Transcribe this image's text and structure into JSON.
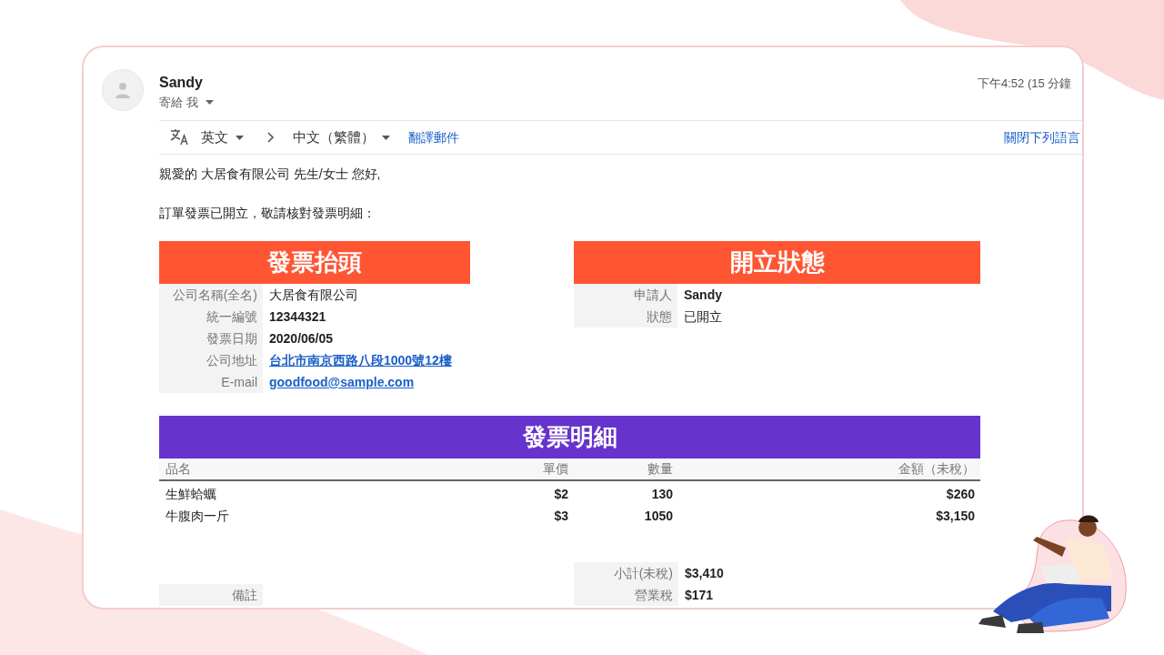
{
  "email": {
    "sender": "Sandy",
    "recipient": "寄給 我",
    "time": "下午4:52 (15 分鐘"
  },
  "translate_bar": {
    "from_language": "英文",
    "to_language": "中文（繁體）",
    "translate": "翻譯郵件",
    "turn_off": "關閉下列語言"
  },
  "greeting": "親愛的 大居食有限公司 先生/女士 您好,",
  "intro": "訂單發票已開立，敬請核對發票明細：",
  "invoice_header": {
    "title": "發票抬頭",
    "rows": [
      {
        "label": "公司名稱(全名)",
        "value": "大居食有限公司",
        "kind": "plain"
      },
      {
        "label": "統一編號",
        "value": "12344321",
        "kind": "bold"
      },
      {
        "label": "發票日期",
        "value": "2020/06/05",
        "kind": "bold"
      },
      {
        "label": "公司地址",
        "value": "台北市南京西路八段1000號12樓",
        "kind": "link"
      },
      {
        "label": "E-mail",
        "value": "goodfood@sample.com",
        "kind": "link"
      }
    ]
  },
  "issue_status": {
    "title": "開立狀態",
    "rows": [
      {
        "label": "申請人",
        "value": "Sandy",
        "kind": "bold"
      },
      {
        "label": "狀態",
        "value": "已開立",
        "kind": "plain"
      }
    ]
  },
  "invoice_details": {
    "title": "發票明細",
    "columns": [
      "品名",
      "單價",
      "數量",
      "金額（未稅）"
    ],
    "rows": [
      [
        "生鮮蛤蠣",
        "$2",
        "130",
        "$260"
      ],
      [
        "牛腹肉一斤",
        "$3",
        "1050",
        "$3,150"
      ]
    ]
  },
  "totals": [
    {
      "label": "小計(未稅)",
      "value": "$3,410"
    },
    {
      "label": "營業稅",
      "value": "$171"
    }
  ],
  "remarks": {
    "label": "備註"
  }
}
